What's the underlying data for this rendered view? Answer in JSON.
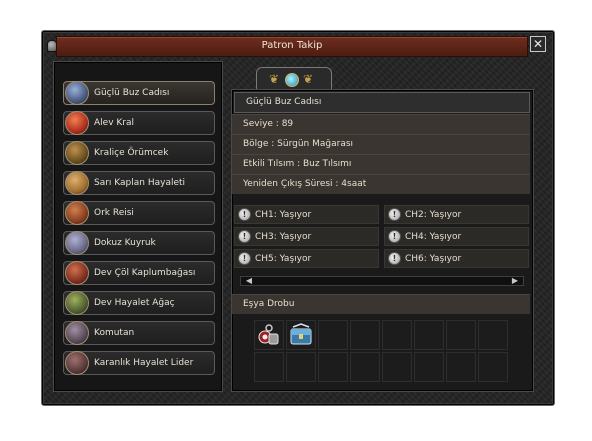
{
  "window": {
    "title": "Patron Takip"
  },
  "bosses": [
    {
      "label": "Güçlü Buz Cadısı",
      "color": "#4a5a80"
    },
    {
      "label": "Alev Kral",
      "color": "#b03020"
    },
    {
      "label": "Kraliçe Örümcek",
      "color": "#6a5020"
    },
    {
      "label": "Sarı Kaplan Hayaleti",
      "color": "#a07030"
    },
    {
      "label": "Ork Reisi",
      "color": "#8a4020"
    },
    {
      "label": "Dokuz Kuyruk",
      "color": "#6a6a8a"
    },
    {
      "label": "Dev Çöl Kaplumbağası",
      "color": "#803020"
    },
    {
      "label": "Dev Hayalet Ağaç",
      "color": "#506030"
    },
    {
      "label": "Komutan",
      "color": "#5a4a5a"
    },
    {
      "label": "Karanlık Hayalet Lider",
      "color": "#5a3a3a"
    }
  ],
  "detail": {
    "name": "Güçlü Buz Cadısı",
    "level": "Seviye : 89",
    "region": "Bölge : Sürgün Mağarası",
    "spell": "Etkili Tılsım : Buz Tılsımı",
    "respawn": "Yeniden Çıkış Süresi : 4saat"
  },
  "channels": [
    {
      "label": "CH1: Yaşıyor"
    },
    {
      "label": "CH2: Yaşıyor"
    },
    {
      "label": "CH3: Yaşıyor"
    },
    {
      "label": "CH4: Yaşıyor"
    },
    {
      "label": "CH5: Yaşıyor"
    },
    {
      "label": "CH6: Yaşıyor"
    }
  ],
  "drop": {
    "label": "Eşya Drobu"
  },
  "colors": {
    "title_bar": "#5e2517",
    "text": "#e6dfcf",
    "accent_gold": "#c8a24a"
  }
}
